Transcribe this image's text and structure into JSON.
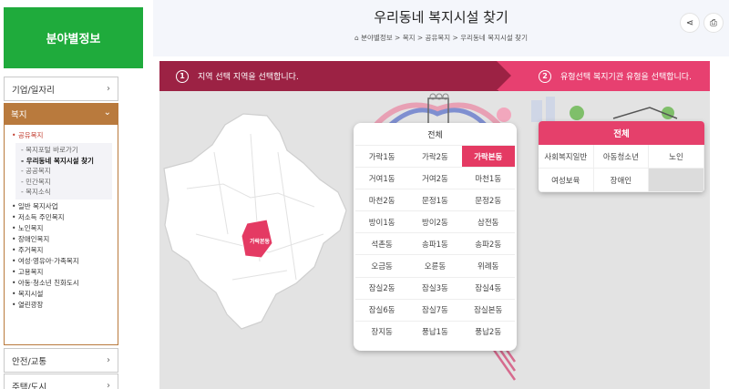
{
  "sidebar": {
    "title": "분야별정보",
    "menu": [
      {
        "label": "기업/일자리"
      },
      {
        "label": "안전/교통"
      },
      {
        "label": "주택/도시"
      }
    ],
    "welfare": {
      "label": "복지",
      "items": [
        {
          "label": "공유복지",
          "active": true,
          "children": [
            {
              "label": "복지포털 바로가기"
            },
            {
              "label": "우리동네 복지시설 찾기",
              "active": true
            },
            {
              "label": "공공복지"
            },
            {
              "label": "민간복지"
            },
            {
              "label": "복지소식"
            }
          ]
        },
        {
          "label": "일반 복지사업"
        },
        {
          "label": "저소득 주민복지"
        },
        {
          "label": "노인복지"
        },
        {
          "label": "장애인복지"
        },
        {
          "label": "주거복지"
        },
        {
          "label": "여성·영유아·가족복지"
        },
        {
          "label": "고용복지"
        },
        {
          "label": "아동·청소년 친화도시"
        },
        {
          "label": "복지시설"
        },
        {
          "label": "열린광장"
        }
      ]
    }
  },
  "header": {
    "title": "우리동네 복지시설 찾기",
    "breadcrumb": "분야별정보 > 복지 > 공유복지 > 우리동네 복지시설 찾기",
    "share_icon": "share-icon",
    "print_icon": "print-icon"
  },
  "steps": {
    "step1": {
      "num": "1",
      "label": "지역 선택 지역을 선택합니다."
    },
    "step2": {
      "num": "2",
      "label": "유형선택 복지기관 유형을 선택합니다."
    }
  },
  "map": {
    "selected_label": "가락본동"
  },
  "region": {
    "all_label": "전체",
    "selected": "가락본동",
    "options": [
      "가락1동",
      "가락2동",
      "가락본동",
      "거여1동",
      "거여2동",
      "마천1동",
      "마천2동",
      "문정1동",
      "문정2동",
      "방이1동",
      "방이2동",
      "삼전동",
      "석촌동",
      "송파1동",
      "송파2동",
      "오금동",
      "오륜동",
      "위례동",
      "잠실2동",
      "잠실3동",
      "잠실4동",
      "잠실6동",
      "잠실7동",
      "잠실본동",
      "장지동",
      "풍납1동",
      "풍납2동"
    ]
  },
  "type": {
    "all_label": "전체",
    "options": [
      "사회복지일반",
      "아동청소년",
      "노인",
      "여성보육",
      "장애인"
    ]
  },
  "colors": {
    "green": "#1fab3c",
    "brown": "#b97a3d",
    "dark_red": "#9c2244",
    "pink": "#e43a63"
  }
}
